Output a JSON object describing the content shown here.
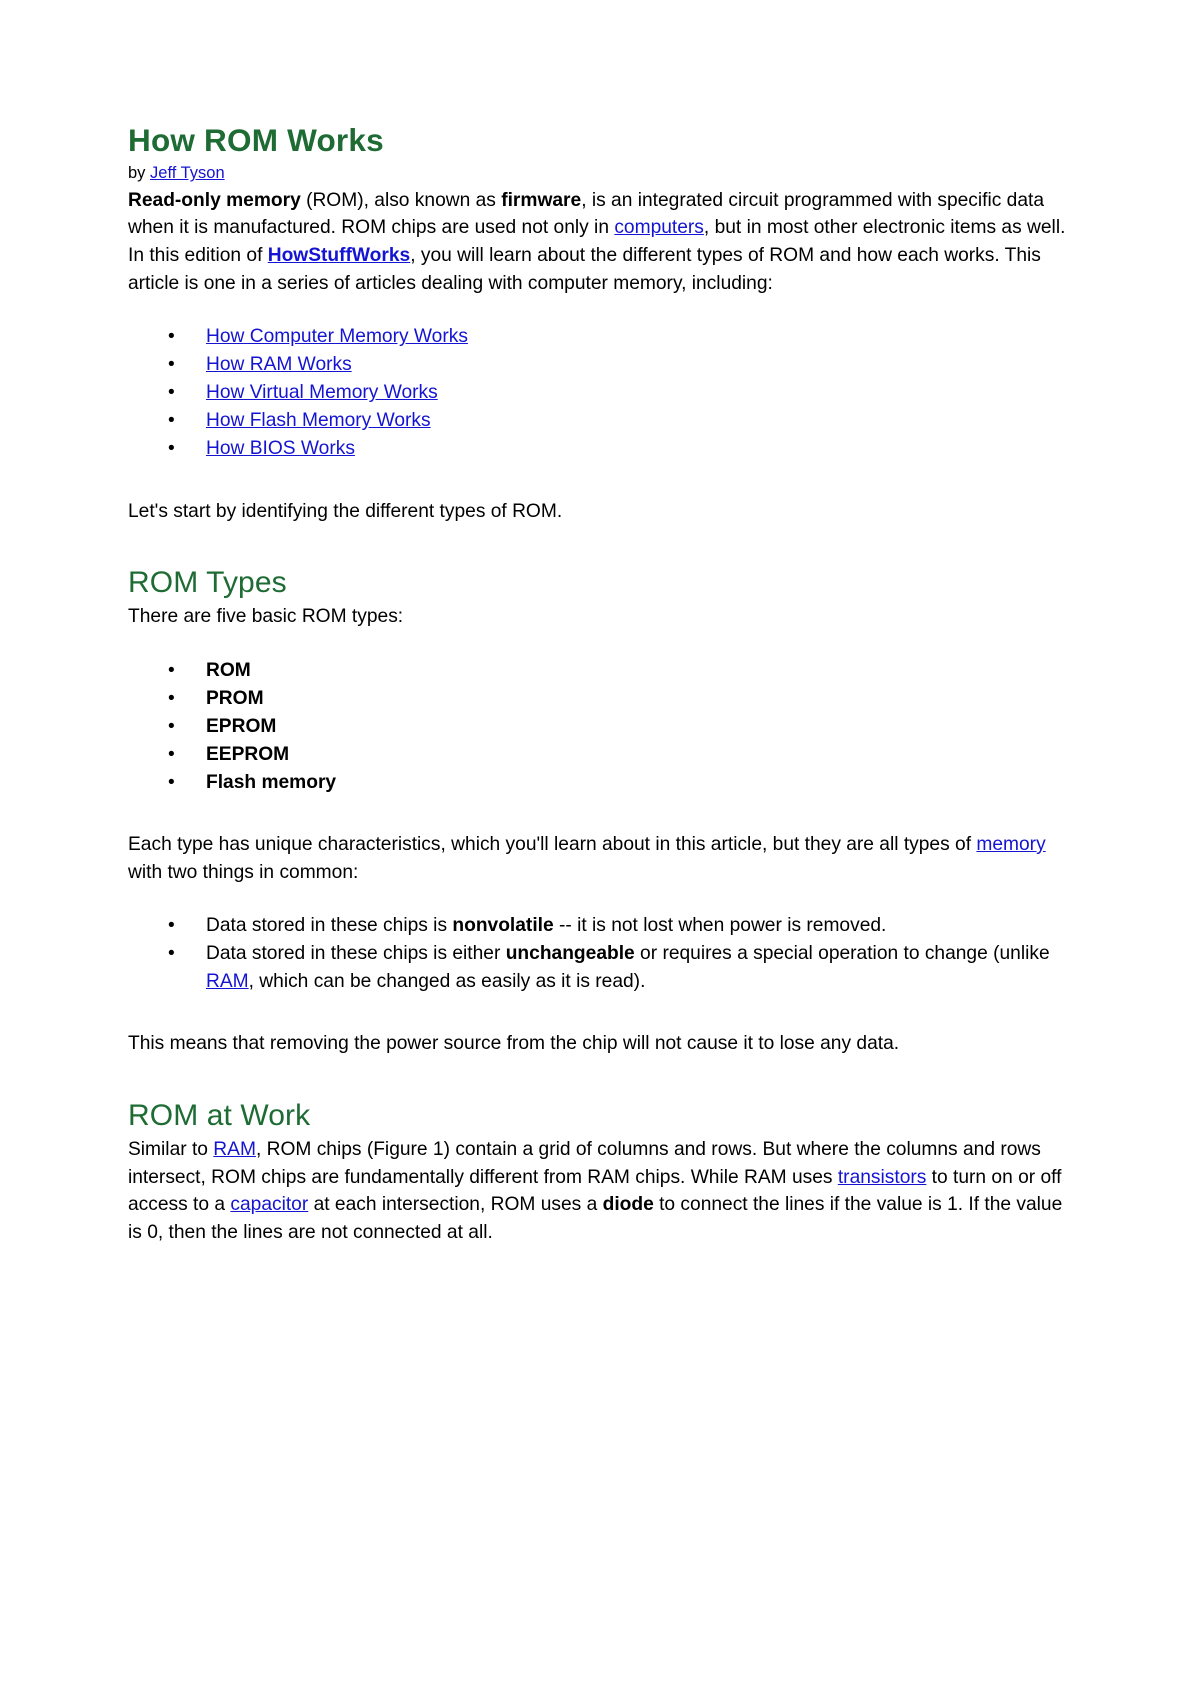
{
  "document": {
    "title": "How ROM Works",
    "byline_prefix": "by ",
    "byline_author": "Jeff Tyson"
  },
  "intro": {
    "part1_bold": "Read-only memory",
    "part2": " (ROM), also known as ",
    "part3_bold": "firmware",
    "part4": ", is an integrated circuit programmed with specific data when it is manufactured. ROM chips are used not only in ",
    "link_computers": "computers",
    "part5": ", but in most other electronic items as well. In this edition of ",
    "link_hsw": "HowStuffWorks",
    "part6": ", you will learn about the different types of ROM and how each works. This article is one in a series of articles dealing with computer memory, including:"
  },
  "related_links": [
    {
      "label": "How Computer Memory Works"
    },
    {
      "label": "How RAM Works"
    },
    {
      "label": "How Virtual Memory Works"
    },
    {
      "label": "How Flash Memory Works"
    },
    {
      "label": "How BIOS Works"
    }
  ],
  "lets_start": "Let's start by identifying the different types of ROM.",
  "rom_types": {
    "heading": "ROM Types",
    "intro": "There are five basic ROM types:",
    "items": [
      {
        "label": "ROM"
      },
      {
        "label": "PROM"
      },
      {
        "label": "EPROM"
      },
      {
        "label": "EEPROM"
      },
      {
        "label": "Flash memory"
      }
    ],
    "after_list_part1": "Each type has unique characteristics, which you'll learn about in this article, but they are all types of ",
    "after_list_link": "memory",
    "after_list_part2": " with two things in common:",
    "commonalities": [
      {
        "pre": "Data stored in these chips is ",
        "bold": "nonvolatile",
        "post": " -- it is not lost when power is removed."
      },
      {
        "pre": "Data stored in these chips is either ",
        "bold": "unchangeable",
        "mid": " or requires a special operation to change (unlike ",
        "link": "RAM",
        "post": ", which can be changed as easily as it is read)."
      }
    ],
    "closing": "This means that removing the power source from the chip will not cause it to lose any data."
  },
  "rom_at_work": {
    "heading": "ROM at Work",
    "p_part1": "Similar to ",
    "p_link_ram": "RAM",
    "p_part2": ", ROM chips (Figure 1) contain a grid of columns and rows. But where the columns and rows intersect, ROM chips are fundamentally different from RAM chips. While RAM uses ",
    "p_link_transistors": "transistors",
    "p_part3": " to turn on or off access to a ",
    "p_link_capacitor": "capacitor",
    "p_part4": " at each intersection, ROM uses a ",
    "p_bold_diode": "diode",
    "p_part5": " to connect the lines if the value is 1. If the value is 0, then the lines are not connected at all."
  },
  "style": {
    "heading_color": "#1e6b34",
    "link_color": "#1414d2",
    "text_color": "#000000",
    "background": "#ffffff"
  }
}
